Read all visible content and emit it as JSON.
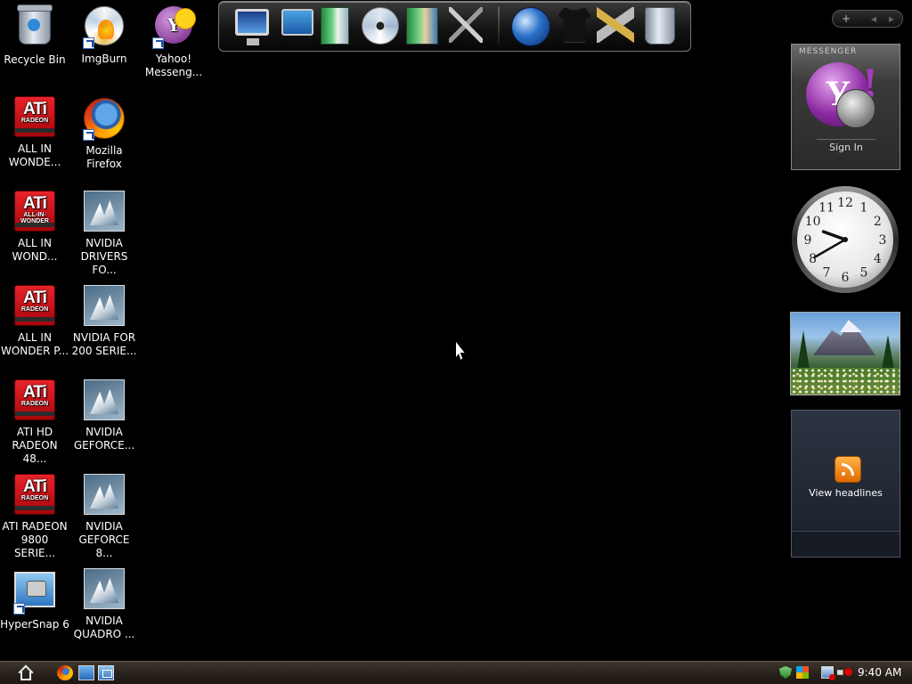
{
  "desktop": {
    "icons": [
      {
        "label": "Recycle Bin"
      },
      {
        "label": "ImgBurn"
      },
      {
        "label": "Yahoo! Messeng..."
      },
      {
        "label": "ALL IN WONDE..."
      },
      {
        "label": "Mozilla Firefox"
      },
      {
        "label": "ALL IN WOND..."
      },
      {
        "label": "NVIDIA DRIVERS FO..."
      },
      {
        "label": "ALL IN WONDER P..."
      },
      {
        "label": "NVIDIA FOR 200 SERIE..."
      },
      {
        "label": "ATI HD RADEON 48..."
      },
      {
        "label": "NVIDIA GEFORCE..."
      },
      {
        "label": "ATI RADEON 9800 SERIE..."
      },
      {
        "label": "NVIDIA GEFORCE 8..."
      },
      {
        "label": "HyperSnap 6"
      },
      {
        "label": "NVIDIA QUADRO ..."
      }
    ],
    "ati_badge": {
      "brand": "ATi",
      "sub_radeon": "RADEON",
      "sub_aiw": "ALL-IN-WONDER"
    }
  },
  "dock": {
    "items": [
      "monitor-icon",
      "laptop-icon",
      "book-icon",
      "disc-icon",
      "photo-album-icon",
      "tools-icon",
      "globe-icon",
      "tshirt-icon",
      "hammer-icon",
      "trash-icon"
    ]
  },
  "gadget_controls": {
    "add": "+",
    "prev": "◂",
    "next": "▸"
  },
  "gadgets": {
    "messenger": {
      "title": "MESSENGER",
      "logo_letter": "Y",
      "logo_bang": "!",
      "signin_label": "Sign In"
    },
    "clock": {
      "numbers": [
        "12",
        "1",
        "2",
        "3",
        "4",
        "5",
        "6",
        "7",
        "8",
        "9",
        "10",
        "11"
      ],
      "hour": 9,
      "minute": 40
    },
    "feed": {
      "label": "View headlines"
    }
  },
  "taskbar": {
    "time": "9:40 AM",
    "quick_launch": [
      "firefox-icon",
      "show-desktop-icon",
      "switch-windows-icon"
    ],
    "tray": [
      "security-shield-icon",
      "windows-flag-icon",
      "network-icon",
      "volume-muted-icon"
    ]
  },
  "colors": {
    "desktop_bg": "#000000",
    "taskbar": "#2a231d",
    "ati_red": "#d0161c"
  }
}
